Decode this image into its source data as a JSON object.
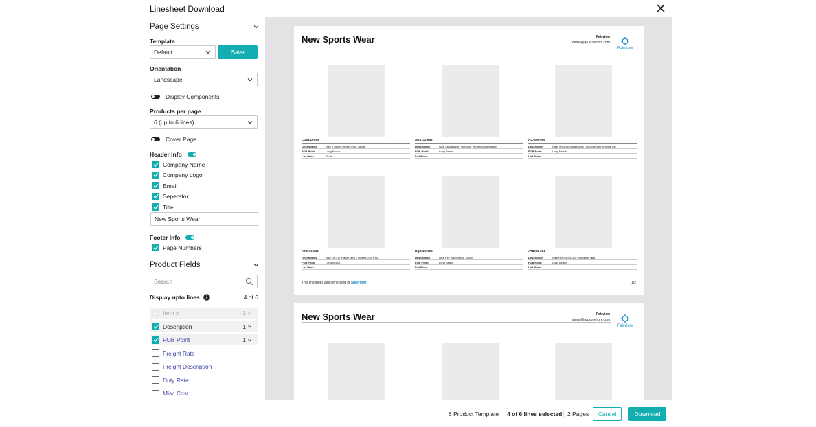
{
  "modal": {
    "title": "Linesheet Download"
  },
  "page_settings": {
    "heading": "Page Settings",
    "template_label": "Template",
    "template_value": "Default",
    "save_label": "Save",
    "orientation_label": "Orientation",
    "orientation_value": "Landscape",
    "display_components_label": "Display Components",
    "products_per_page_label": "Products per page",
    "products_per_page_value": "6 (up to 6 lines)",
    "cover_page_label": "Cover Page",
    "header_info_label": "Header Info",
    "header_items": [
      {
        "label": "Company Name",
        "checked": true
      },
      {
        "label": "Company Logo",
        "checked": true
      },
      {
        "label": "Email",
        "checked": true
      },
      {
        "label": "Seperator",
        "checked": true
      },
      {
        "label": "Title",
        "checked": true
      }
    ],
    "title_value": "New Sports Wear",
    "footer_info_label": "Footer Info",
    "footer_items": [
      {
        "label": "Page Numbers",
        "checked": true
      }
    ]
  },
  "product_fields": {
    "heading": "Product Fields",
    "search_placeholder": "Search",
    "display_lines_label": "Display upto lines",
    "display_lines_count": "4 of 6",
    "fields": [
      {
        "label": "Item #",
        "state": "disabled",
        "count": "1"
      },
      {
        "label": "Description",
        "state": "checked",
        "count": "1"
      },
      {
        "label": "FOB Point",
        "state": "checked",
        "count": "1"
      },
      {
        "label": "Freight Rate",
        "state": "unchecked",
        "count": ""
      },
      {
        "label": "Freight Description",
        "state": "unchecked",
        "count": ""
      },
      {
        "label": "Duty Rate",
        "state": "unchecked",
        "count": ""
      },
      {
        "label": "Misc Cost",
        "state": "unchecked",
        "count": ""
      }
    ]
  },
  "preview": {
    "page_title": "New Sports Wear",
    "company_name": "Fairview",
    "company_email": "demo@qa.surefront.com",
    "logo_text": "Fairview",
    "generated_text": "This linesheet was generated in",
    "generated_brand": "Surefront",
    "page_number": "1/2",
    "row_keys": [
      "Description",
      "FOB Point",
      "List Price"
    ],
    "products": [
      {
        "code": "CD6132-639",
        "description": "Nike x atmos Men's Track Jacket",
        "fob": "Long Beach",
        "price": "79.99"
      },
      {
        "code": "AR3132-668",
        "description": "Nike Sportswear \"Swoosh\" Woven Windbreaker",
        "fob": "Long Beach",
        "price": ""
      },
      {
        "code": "AJ7626-056",
        "description": "Nike TechKnit Ultra Men's Long-Sleeve Running Top",
        "fob": "Long Beach",
        "price": ""
      },
      {
        "code": "AT8946-543",
        "description": "Nike Dri-FIT Player Men's Striped Golf Polo",
        "fob": "Long Beach",
        "price": ""
      },
      {
        "code": "BQ8320-605",
        "description": "Nike Pro Women's 3\" Shorts",
        "fob": "Long Beach",
        "price": ""
      },
      {
        "code": "AT8081-304",
        "description": "Nike Pro HyperCool Women's Tank",
        "fob": "Long Beach",
        "price": ""
      }
    ]
  },
  "footer": {
    "template_info": "6 Product Template",
    "lines_selected": "4 of 6 lines selected",
    "pages": "2 Pages",
    "cancel_label": "Cancel",
    "download_label": "Download"
  },
  "colors": {
    "accent": "#12aeb0",
    "link": "#3b3fa6",
    "preview_bg": "#e3e3e5"
  }
}
